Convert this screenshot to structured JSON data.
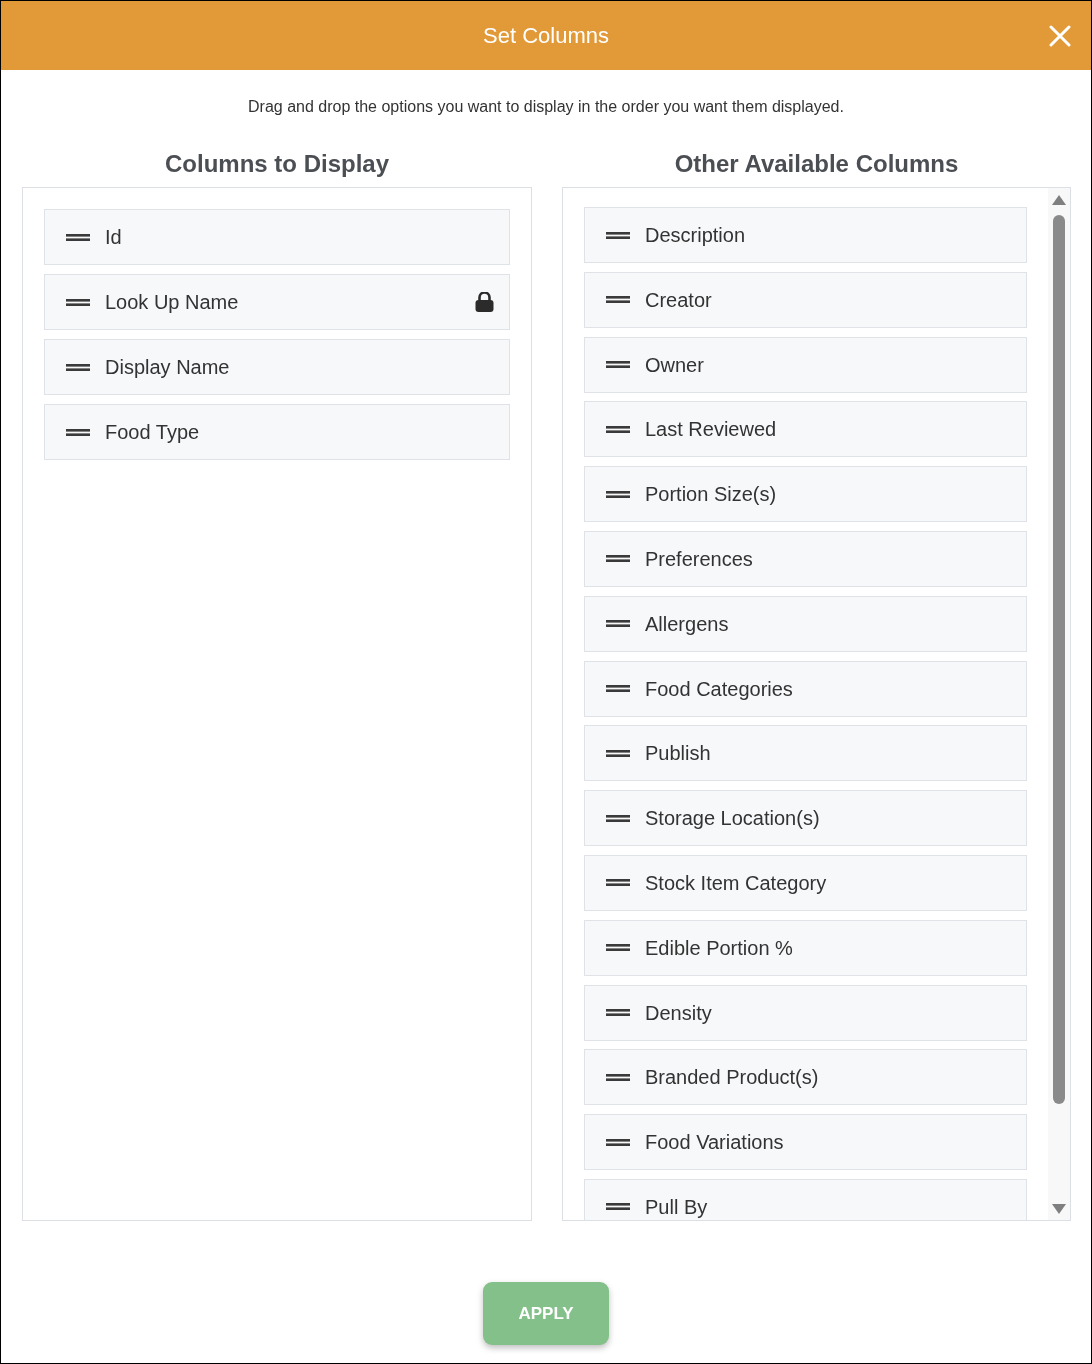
{
  "dialog": {
    "title": "Set Columns",
    "instructions": "Drag and drop the options you want to display in the order you want them displayed.",
    "columns_to_display": {
      "heading": "Columns to Display",
      "items": [
        {
          "label": "Id",
          "locked": false
        },
        {
          "label": "Look Up Name",
          "locked": true
        },
        {
          "label": "Display Name",
          "locked": false
        },
        {
          "label": "Food Type",
          "locked": false
        }
      ]
    },
    "other_available_columns": {
      "heading": "Other Available Columns",
      "items": [
        {
          "label": "Description"
        },
        {
          "label": "Creator"
        },
        {
          "label": "Owner"
        },
        {
          "label": "Last Reviewed"
        },
        {
          "label": "Portion Size(s)"
        },
        {
          "label": "Preferences"
        },
        {
          "label": "Allergens"
        },
        {
          "label": "Food Categories"
        },
        {
          "label": "Publish"
        },
        {
          "label": "Storage Location(s)"
        },
        {
          "label": "Stock Item Category"
        },
        {
          "label": "Edible Portion %"
        },
        {
          "label": "Density"
        },
        {
          "label": "Branded Product(s)"
        },
        {
          "label": "Food Variations"
        },
        {
          "label": "Pull By"
        }
      ]
    },
    "apply_button": "APPLY"
  }
}
